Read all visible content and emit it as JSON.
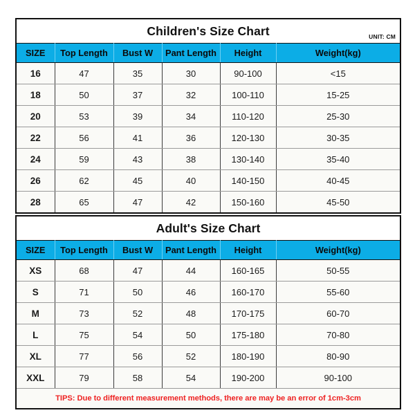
{
  "children": {
    "title": "Children's Size Chart",
    "unit_label": "UNIT: CM",
    "columns": [
      "SIZE",
      "Top Length",
      "Bust W",
      "Pant Length",
      "Height",
      "Weight(kg)"
    ],
    "rows": [
      [
        "16",
        "47",
        "35",
        "30",
        "90-100",
        "<15"
      ],
      [
        "18",
        "50",
        "37",
        "32",
        "100-110",
        "15-25"
      ],
      [
        "20",
        "53",
        "39",
        "34",
        "110-120",
        "25-30"
      ],
      [
        "22",
        "56",
        "41",
        "36",
        "120-130",
        "30-35"
      ],
      [
        "24",
        "59",
        "43",
        "38",
        "130-140",
        "35-40"
      ],
      [
        "26",
        "62",
        "45",
        "40",
        "140-150",
        "40-45"
      ],
      [
        "28",
        "65",
        "47",
        "42",
        "150-160",
        "45-50"
      ]
    ]
  },
  "adult": {
    "title": "Adult's Size Chart",
    "columns": [
      "SIZE",
      "Top Length",
      "Bust W",
      "Pant Length",
      "Height",
      "Weight(kg)"
    ],
    "rows": [
      [
        "XS",
        "68",
        "47",
        "44",
        "160-165",
        "50-55"
      ],
      [
        "S",
        "71",
        "50",
        "46",
        "160-170",
        "55-60"
      ],
      [
        "M",
        "73",
        "52",
        "48",
        "170-175",
        "60-70"
      ],
      [
        "L",
        "75",
        "54",
        "50",
        "175-180",
        "70-80"
      ],
      [
        "XL",
        "77",
        "56",
        "52",
        "180-190",
        "80-90"
      ],
      [
        "XXL",
        "79",
        "58",
        "54",
        "190-200",
        "90-100"
      ]
    ],
    "tips": "TIPS: Due to different measurement methods, there are may be an error of 1cm-3cm"
  },
  "colors": {
    "header_blue": "#0CADE6",
    "tips_red": "#EE2222",
    "cell_background": "#FAFAF7",
    "border_black": "#111111"
  }
}
